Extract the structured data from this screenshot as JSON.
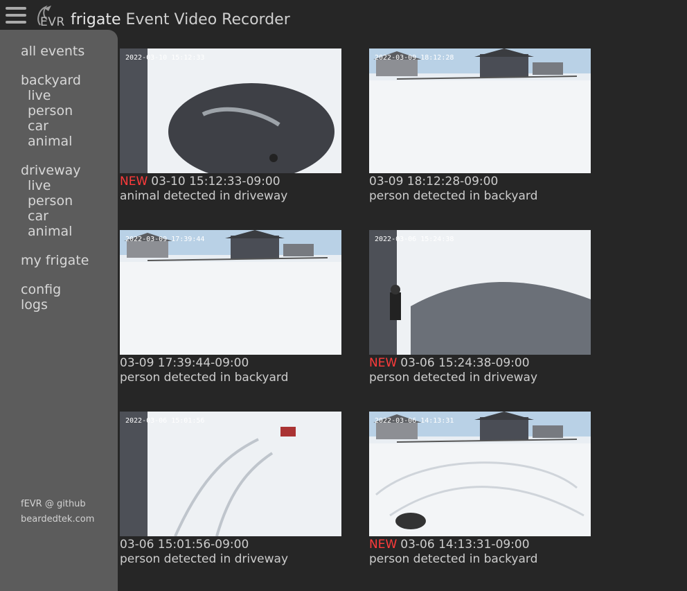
{
  "header": {
    "logo_text": "EVR",
    "title_brand": "frigate",
    "title_rest": "Event Video Recorder"
  },
  "sidebar": {
    "all_events": "all events",
    "cameras": [
      {
        "name": "backyard",
        "items": [
          "live",
          "person",
          "car",
          "animal"
        ]
      },
      {
        "name": "driveway",
        "items": [
          "live",
          "person",
          "car",
          "animal"
        ]
      }
    ],
    "my_frigate": "my frigate",
    "config": "config",
    "logs": "logs",
    "footer_github": "fEVR @ github",
    "footer_site": "beardedtek.com"
  },
  "new_label": "NEW",
  "events": [
    {
      "new": true,
      "time": "03-10 15:12:33-09:00",
      "desc": "animal detected in driveway",
      "stamp": "2022-03-10 15:12:33",
      "scene": "driveway-dark"
    },
    {
      "new": false,
      "time": "03-09 18:12:28-09:00",
      "desc": "person detected in backyard",
      "stamp": "2022-03-09 18:12:28",
      "scene": "backyard"
    },
    {
      "new": false,
      "time": "03-09 17:39:44-09:00",
      "desc": "person detected in backyard",
      "stamp": "2022-03-09 17:39:44",
      "scene": "backyard"
    },
    {
      "new": true,
      "time": "03-06 15:24:38-09:00",
      "desc": "person detected in driveway",
      "stamp": "2022-03-06 15:24:38",
      "scene": "driveway-person"
    },
    {
      "new": false,
      "time": "03-06 15:01:56-09:00",
      "desc": "person detected in driveway",
      "stamp": "2022-03-06 15:01:56",
      "scene": "driveway-tracks"
    },
    {
      "new": true,
      "time": "03-06 14:13:31-09:00",
      "desc": "person detected in backyard",
      "stamp": "2022-03-06 14:13:31",
      "scene": "backyard-tracks"
    }
  ],
  "colors": {
    "new": "#ff3b3b",
    "sidebar": "#5c5c5c",
    "background": "#262626"
  }
}
